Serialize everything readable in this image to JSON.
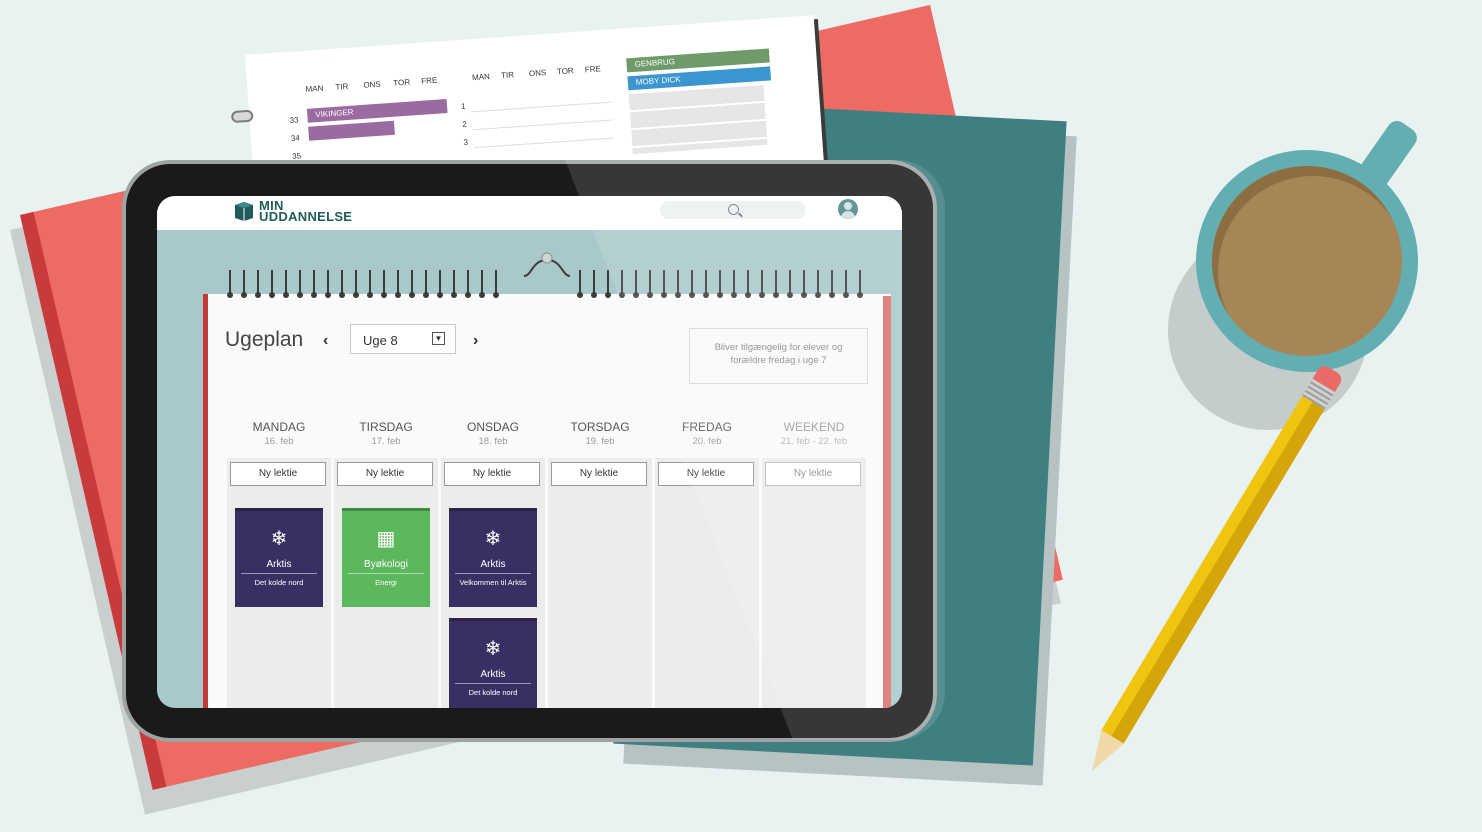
{
  "planner": {
    "week_days_left": [
      "MAN",
      "TIR",
      "ONS",
      "TOR",
      "FRE"
    ],
    "week_days_right": [
      "MAN",
      "TIR",
      "ONS",
      "TOR",
      "FRE"
    ],
    "week_numbers": [
      "33",
      "34",
      "35"
    ],
    "row_numbers": [
      "1",
      "2",
      "3"
    ],
    "bars": [
      {
        "label": "VIKINGER",
        "color": "#9b6aa0"
      },
      {
        "label": "GENBRUG",
        "color": "#6f9a6a"
      },
      {
        "label": "MOBY DICK",
        "color": "#3b95cf"
      }
    ]
  },
  "app": {
    "logo_line1": "MIN",
    "logo_line2": "UDDANNELSE"
  },
  "calendar": {
    "title": "Ugeplan",
    "week_label": "Uge 8",
    "notice": "Bliver tilgængelig for elever og forældre fredag i uge 7",
    "new_lesson_label": "Ny lektie",
    "days": [
      {
        "name": "MANDAG",
        "date": "16. feb"
      },
      {
        "name": "TIRSDAG",
        "date": "17. feb"
      },
      {
        "name": "ONSDAG",
        "date": "18. feb"
      },
      {
        "name": "TORSDAG",
        "date": "19. feb"
      },
      {
        "name": "FREDAG",
        "date": "20. feb"
      },
      {
        "name": "WEEKEND",
        "date": "21. feb - 22. feb"
      }
    ],
    "lessons": [
      {
        "title": "Arktis",
        "subtitle": "Det kolde nord",
        "icon": "snowflake-icon",
        "color": "#3a2f63"
      },
      {
        "title": "Byøkologi",
        "subtitle": "Energi",
        "icon": "building-icon",
        "color": "#5cb85c"
      },
      {
        "title": "Arktis",
        "subtitle": "Velkommen til Arktis",
        "icon": "snowflake-icon",
        "color": "#3a2f63"
      },
      {
        "title": "Arktis",
        "subtitle": "Det kolde nord",
        "icon": "snowflake-icon",
        "color": "#3a2f63"
      }
    ]
  }
}
